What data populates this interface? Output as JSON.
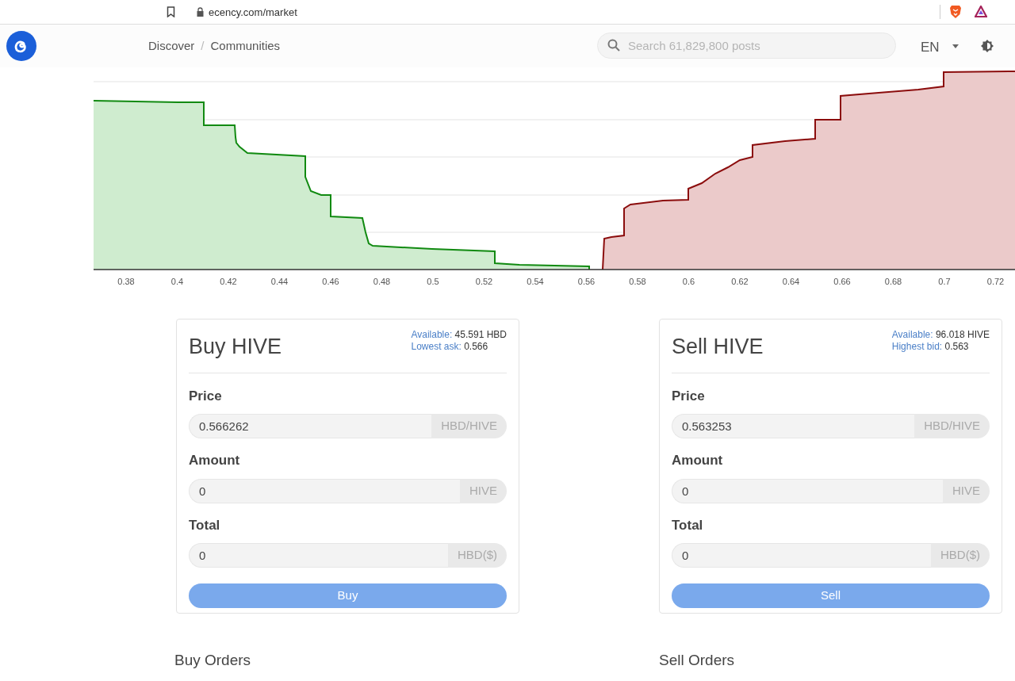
{
  "browser": {
    "url": "ecency.com/market"
  },
  "header": {
    "breadcrumbs": [
      "Discover",
      "Communities"
    ],
    "separator": "/",
    "search": {
      "placeholder": "Search 61,829,800 posts"
    },
    "language": "EN"
  },
  "depth_chart": {
    "x_axis_labels": [
      "0.38",
      "0.4",
      "0.42",
      "0.44",
      "0.46",
      "0.48",
      "0.5",
      "0.52",
      "0.54",
      "0.56",
      "0.58",
      "0.6",
      "0.62",
      "0.64",
      "0.66",
      "0.68",
      "0.7",
      "0.72"
    ]
  },
  "forms": [
    {
      "title": "Buy HIVE",
      "info": [
        {
          "label": "Available:",
          "value": "45.591 HBD"
        },
        {
          "label": "Lowest ask:",
          "value": "0.566"
        }
      ],
      "fields": [
        {
          "label": "Price",
          "value": "0.566262",
          "unit": "HBD/HIVE"
        },
        {
          "label": "Amount",
          "value": "0",
          "unit": "HIVE"
        },
        {
          "label": "Total",
          "value": "0",
          "unit": "HBD($)"
        }
      ],
      "button": "Buy"
    },
    {
      "title": "Sell HIVE",
      "info": [
        {
          "label": "Available:",
          "value": "96.018 HIVE"
        },
        {
          "label": "Highest bid:",
          "value": "0.563"
        }
      ],
      "fields": [
        {
          "label": "Price",
          "value": "0.563253",
          "unit": "HBD/HIVE"
        },
        {
          "label": "Amount",
          "value": "0",
          "unit": "HIVE"
        },
        {
          "label": "Total",
          "value": "0",
          "unit": "HBD($)"
        }
      ],
      "button": "Sell"
    }
  ],
  "order_sections": [
    "Buy Orders",
    "Sell Orders"
  ]
}
